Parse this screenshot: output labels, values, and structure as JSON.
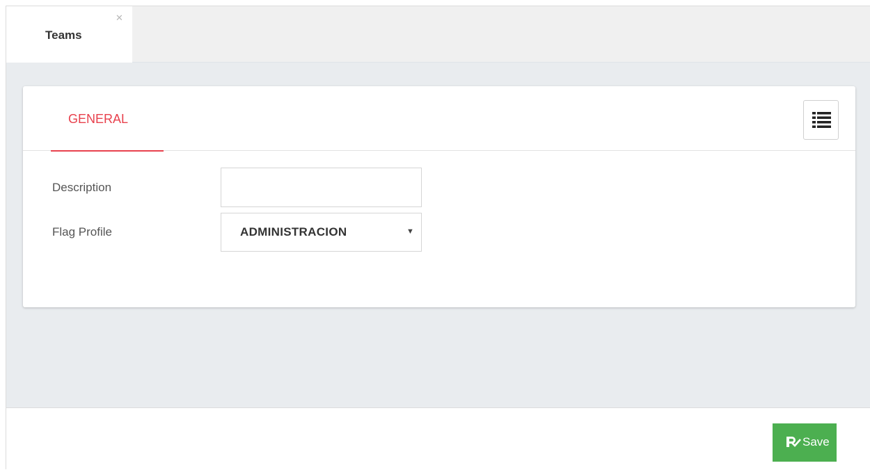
{
  "tabs": [
    {
      "label": "Teams",
      "close_icon": "close-icon"
    }
  ],
  "card": {
    "tab_label": "GENERAL",
    "accent_color": "#e8414d",
    "menu_icon": "list-icon"
  },
  "form": {
    "description": {
      "label": "Description",
      "value": "",
      "placeholder": ""
    },
    "flag_profile": {
      "label": "Flag Profile",
      "value": "ADMINISTRACION"
    }
  },
  "footer": {
    "save_label": "Save",
    "save_icon": "save-check-icon",
    "save_color": "#4caf50"
  }
}
